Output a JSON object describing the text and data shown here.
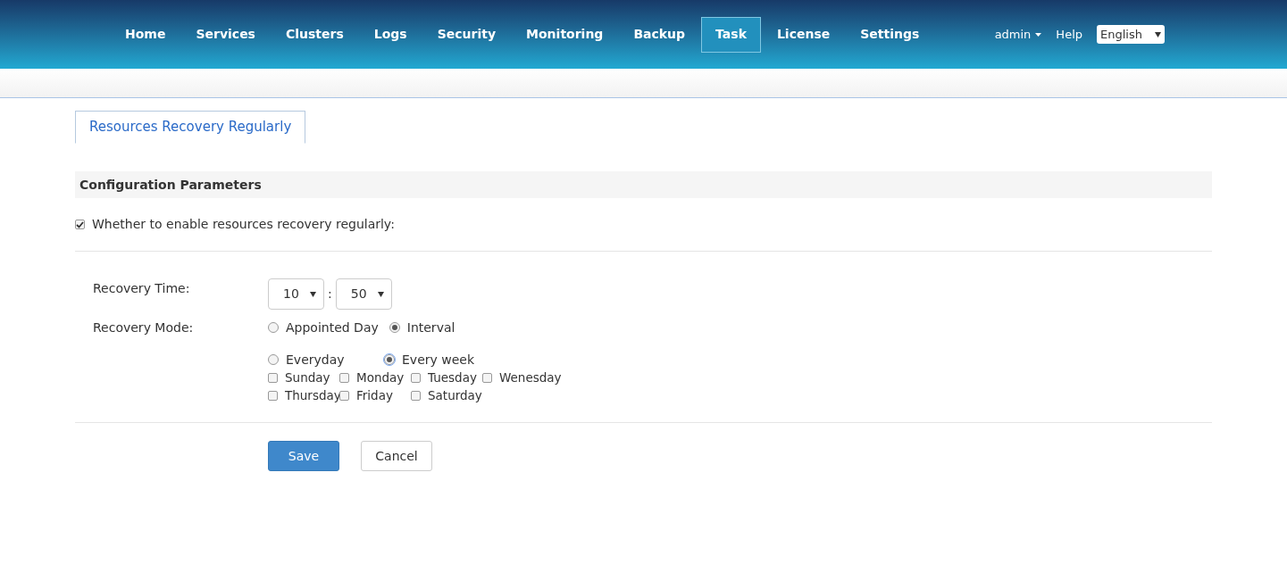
{
  "nav": {
    "items": [
      {
        "label": "Home",
        "selected": false
      },
      {
        "label": "Services",
        "selected": false
      },
      {
        "label": "Clusters",
        "selected": false
      },
      {
        "label": "Logs",
        "selected": false
      },
      {
        "label": "Security",
        "selected": false
      },
      {
        "label": "Monitoring",
        "selected": false
      },
      {
        "label": "Backup",
        "selected": false
      },
      {
        "label": "Task",
        "selected": true
      },
      {
        "label": "License",
        "selected": false
      },
      {
        "label": "Settings",
        "selected": false
      }
    ],
    "user": "admin",
    "help": "Help",
    "language": "English"
  },
  "page_tabs": [
    {
      "label": "Resources Recovery Regularly",
      "selected": true
    }
  ],
  "section_title": "Configuration Parameters",
  "enable": {
    "label": "Whether to enable resources recovery regularly:",
    "checked": true
  },
  "recovery_time": {
    "label": "Recovery Time:",
    "hour": "10",
    "separator": ":",
    "minute": "50"
  },
  "recovery_mode": {
    "label": "Recovery Mode:",
    "modes": [
      {
        "label": "Appointed Day",
        "selected": false
      },
      {
        "label": "Interval",
        "selected": true
      }
    ],
    "intervals": [
      {
        "label": "Everyday",
        "selected": false
      },
      {
        "label": "Every week",
        "selected": true
      }
    ],
    "days": [
      {
        "label": "Sunday",
        "checked": false
      },
      {
        "label": "Monday",
        "checked": false
      },
      {
        "label": "Tuesday",
        "checked": false
      },
      {
        "label": "Wenesday",
        "checked": false
      },
      {
        "label": "Thursday",
        "checked": false
      },
      {
        "label": "Friday",
        "checked": false
      },
      {
        "label": "Saturday",
        "checked": false
      }
    ]
  },
  "buttons": [
    {
      "label": "Save",
      "kind": "primary"
    },
    {
      "label": "Cancel",
      "kind": "default"
    }
  ]
}
